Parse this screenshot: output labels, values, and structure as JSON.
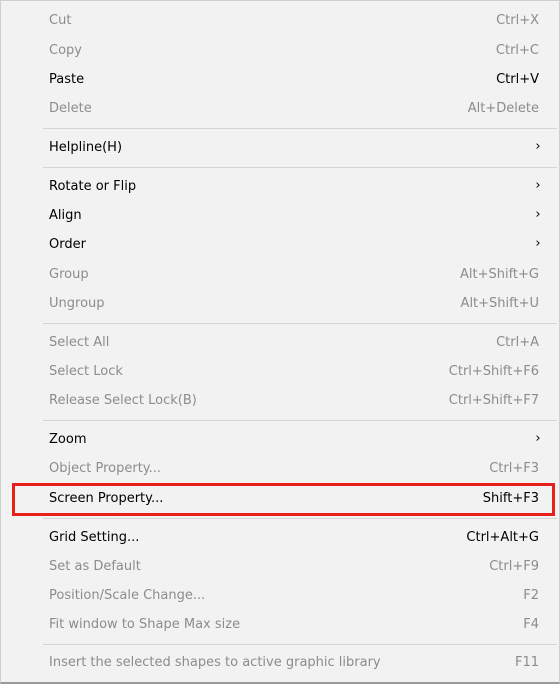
{
  "menu": {
    "items": [
      {
        "label": "Cut",
        "shortcut": "Ctrl+X"
      },
      {
        "label": "Copy",
        "shortcut": "Ctrl+C"
      },
      {
        "label": "Paste",
        "shortcut": "Ctrl+V"
      },
      {
        "label": "Delete",
        "shortcut": "Alt+Delete"
      },
      {
        "label": "Helpline(H)",
        "shortcut": "",
        "arrow": "›"
      },
      {
        "label": "Rotate or Flip",
        "shortcut": "",
        "arrow": "›"
      },
      {
        "label": "Align",
        "shortcut": "",
        "arrow": "›"
      },
      {
        "label": "Order",
        "shortcut": "",
        "arrow": "›"
      },
      {
        "label": "Group",
        "shortcut": "Alt+Shift+G"
      },
      {
        "label": "Ungroup",
        "shortcut": "Alt+Shift+U"
      },
      {
        "label": "Select All",
        "shortcut": "Ctrl+A"
      },
      {
        "label": "Select Lock",
        "shortcut": "Ctrl+Shift+F6"
      },
      {
        "label": "Release Select Lock(B)",
        "shortcut": "Ctrl+Shift+F7"
      },
      {
        "label": "Zoom",
        "shortcut": "",
        "arrow": "›"
      },
      {
        "label": "Object Property...",
        "shortcut": "Ctrl+F3"
      },
      {
        "label": "Screen Property...",
        "shortcut": "Shift+F3"
      },
      {
        "label": "Grid Setting...",
        "shortcut": "Ctrl+Alt+G"
      },
      {
        "label": "Set as Default",
        "shortcut": "Ctrl+F9"
      },
      {
        "label": "Position/Scale Change...",
        "shortcut": "F2"
      },
      {
        "label": "Fit window to Shape Max size",
        "shortcut": "F4"
      },
      {
        "label": "Insert the selected shapes to active graphic library",
        "shortcut": "F11"
      }
    ]
  },
  "colors": {
    "menu_background": "#f2f2f2",
    "enabled_text": "#000000",
    "disabled_text": "#8c8c8c",
    "highlight_border": "#e8201c"
  }
}
